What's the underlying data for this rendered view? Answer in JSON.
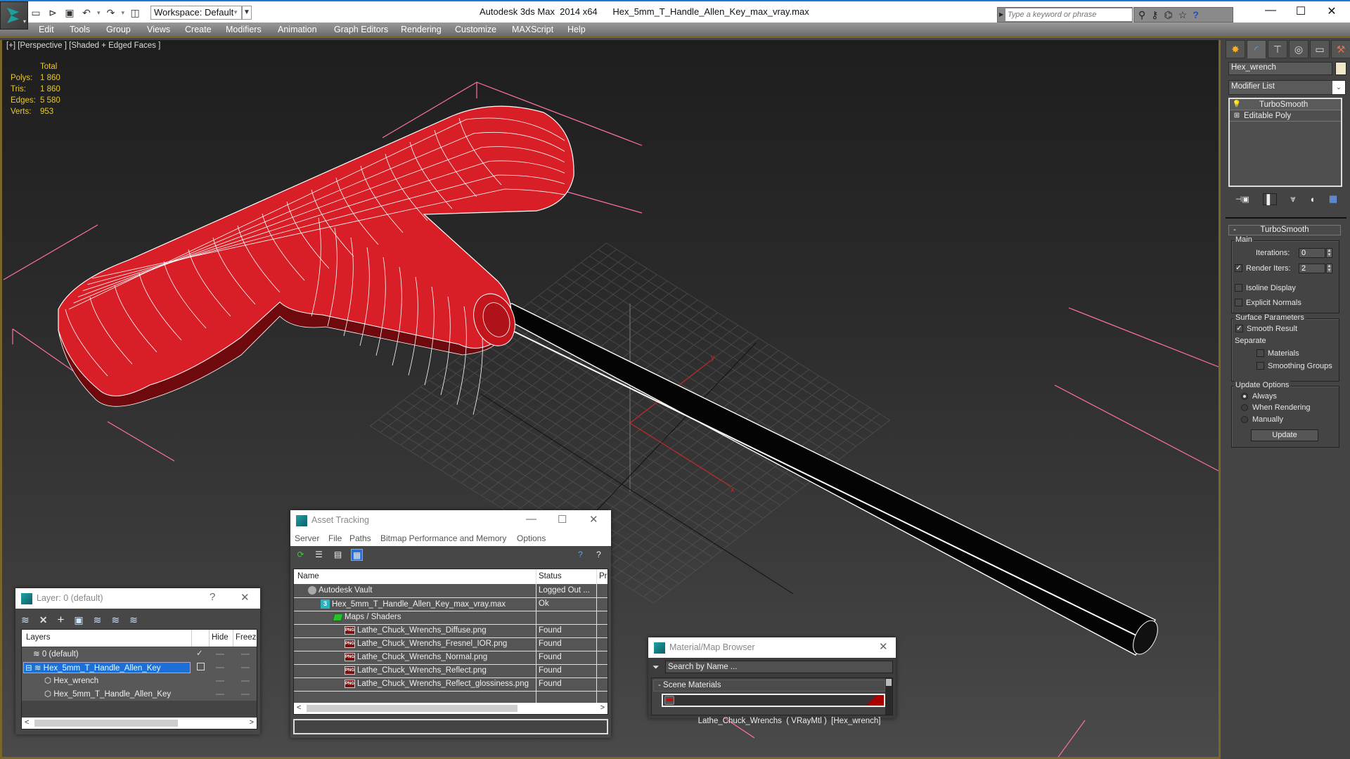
{
  "titlebar": {
    "app_title": "Autodesk 3ds Max  2014 x64",
    "file_name": "Hex_5mm_T_Handle_Allen_Key_max_vray.max",
    "workspace_label": "Workspace: Default",
    "search_placeholder": "Type a keyword or phrase",
    "icons": [
      "new-file-icon",
      "open-file-icon",
      "save-icon",
      "undo-icon",
      "redo-icon",
      "project-folder-icon"
    ],
    "info_icons": [
      "binoculars-icon",
      "key-icon",
      "satellite-icon",
      "star-icon",
      "help-icon"
    ]
  },
  "menu": [
    "Edit",
    "Tools",
    "Group",
    "Views",
    "Create",
    "Modifiers",
    "Animation",
    "Graph Editors",
    "Rendering",
    "Customize",
    "MAXScript",
    "Help"
  ],
  "viewport": {
    "label": "[+] [Perspective ] [Shaded + Edged Faces ]",
    "stats_header": "Total",
    "stats": [
      {
        "label": "Polys:",
        "value": "1 860"
      },
      {
        "label": "Tris:",
        "value": "1 860"
      },
      {
        "label": "Edges:",
        "value": "5 580"
      },
      {
        "label": "Verts:",
        "value": "953"
      }
    ],
    "axis_x": "x",
    "axis_y": "y",
    "handle_color": "#d61f26",
    "shaft_color": "#050505",
    "bbox_color": "#ff6fa8"
  },
  "command_panel": {
    "tabs": [
      "create-tab",
      "modify-tab",
      "hierarchy-tab",
      "motion-tab",
      "display-tab",
      "utilities-tab"
    ],
    "object_name": "Hex_wrench",
    "object_color": "#efe7c8",
    "modifier_list_label": "Modifier List",
    "stack": [
      {
        "label": "TurboSmooth",
        "icon": "lightbulb-icon"
      },
      {
        "label": "Editable Poly",
        "icon": "plus-expand-icon"
      }
    ],
    "turbosmooth": {
      "title": "TurboSmooth",
      "main_label": "Main",
      "iterations_label": "Iterations:",
      "iterations_value": "0",
      "render_iters_label": "Render Iters:",
      "render_iters_value": "2",
      "render_iters_checked": true,
      "isoline_label": "Isoline Display",
      "isoline_checked": false,
      "explicit_normals_label": "Explicit Normals",
      "explicit_normals_checked": false,
      "surface_params_label": "Surface Parameters",
      "smooth_result_label": "Smooth Result",
      "smooth_result_checked": true,
      "separate_label": "Separate",
      "materials_label": "Materials",
      "smoothing_groups_label": "Smoothing Groups",
      "update_options_label": "Update Options",
      "radio_always": "Always",
      "radio_when_rendering": "When Rendering",
      "radio_manually": "Manually",
      "selected_update_option": "Always",
      "update_button": "Update"
    }
  },
  "layer_dialog": {
    "title": "Layer: 0 (default)",
    "help": "?",
    "columns": [
      "Layers",
      "Hide",
      "Freeze"
    ],
    "rows": [
      {
        "name": "0 (default)",
        "type": "layer",
        "current": true
      },
      {
        "name": "Hex_5mm_T_Handle_Allen_Key",
        "type": "layer",
        "selected": true
      },
      {
        "name": "Hex_wrench",
        "type": "object"
      },
      {
        "name": "Hex_5mm_T_Handle_Allen_Key",
        "type": "object"
      }
    ]
  },
  "asset_dialog": {
    "title": "Asset Tracking",
    "menu": [
      "Server",
      "File",
      "Paths",
      "Bitmap Performance and Memory",
      "Options"
    ],
    "columns": [
      "Name",
      "Status",
      "Pr"
    ],
    "rows": [
      {
        "name": "Autodesk Vault",
        "status": "Logged Out ...",
        "icon": "vault-icon"
      },
      {
        "name": "Hex_5mm_T_Handle_Allen_Key_max_vray.max",
        "status": "Ok",
        "icon": "max-file-icon"
      },
      {
        "name": "Maps / Shaders",
        "status": "",
        "icon": "maps-icon"
      },
      {
        "name": "Lathe_Chuck_Wrenchs_Diffuse.png",
        "status": "Found",
        "icon": "png-icon"
      },
      {
        "name": "Lathe_Chuck_Wrenchs_Fresnel_IOR.png",
        "status": "Found",
        "icon": "png-icon"
      },
      {
        "name": "Lathe_Chuck_Wrenchs_Normal.png",
        "status": "Found",
        "icon": "png-icon"
      },
      {
        "name": "Lathe_Chuck_Wrenchs_Reflect.png",
        "status": "Found",
        "icon": "png-icon"
      },
      {
        "name": "Lathe_Chuck_Wrenchs_Reflect_glossiness.png",
        "status": "Found",
        "icon": "png-icon"
      }
    ]
  },
  "material_browser": {
    "title": "Material/Map Browser",
    "search_placeholder": "Search by Name ...",
    "category": "- Scene Materials",
    "item": "Lathe_Chuck_Wrenchs  ( VRayMtl )  [Hex_wrench]"
  }
}
